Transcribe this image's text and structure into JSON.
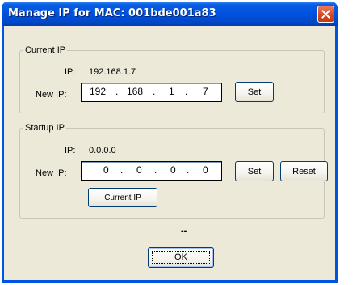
{
  "window": {
    "title": "Manage IP for MAC: 001bde001a83"
  },
  "current_ip": {
    "legend": "Current IP",
    "ip_label": "IP:",
    "ip_value": "192.168.1.7",
    "new_ip_label": "New IP:",
    "octets": [
      "192",
      "168",
      "1",
      "7"
    ],
    "set_label": "Set"
  },
  "startup_ip": {
    "legend": "Startup IP",
    "ip_label": "IP:",
    "ip_value": "0.0.0.0",
    "new_ip_label": "New IP:",
    "octets": [
      "0",
      "0",
      "0",
      "0"
    ],
    "set_label": "Set",
    "reset_label": "Reset",
    "current_ip_label": "Current IP"
  },
  "status_text": "--",
  "ok_label": "OK",
  "colors": {
    "titlebar": "#0054e3",
    "dialog_bg": "#ece9d8",
    "close_button": "#d44a24"
  }
}
